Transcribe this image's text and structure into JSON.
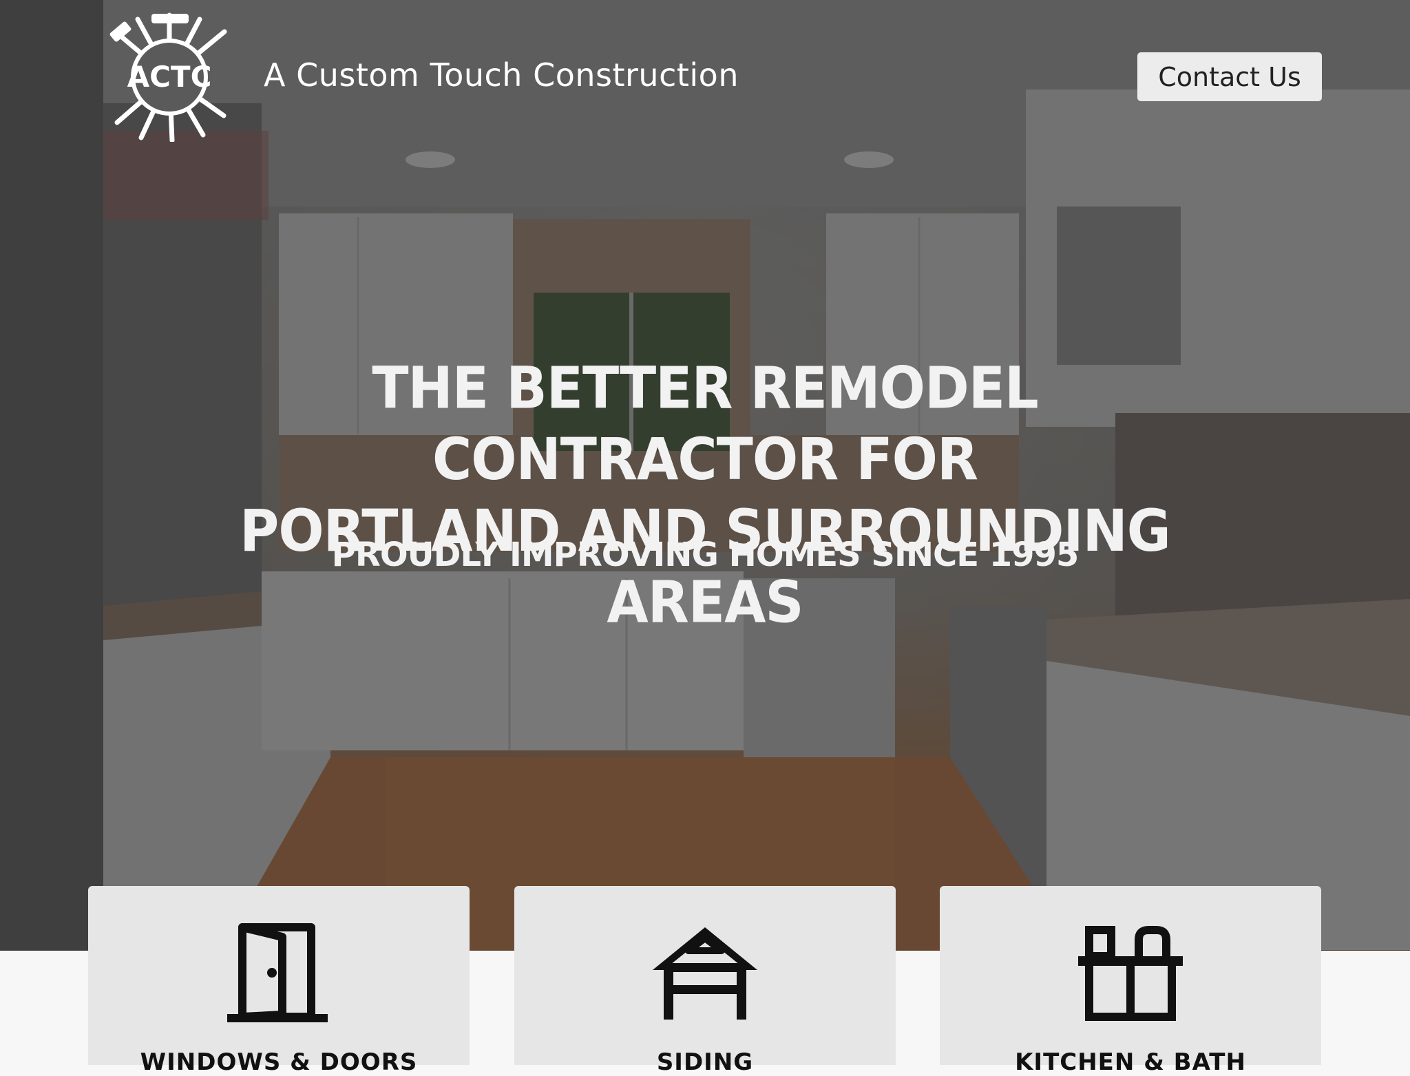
{
  "header": {
    "logo_text": "ACTC",
    "site_title": "A Custom Touch Construction",
    "contact_label": "Contact Us"
  },
  "hero": {
    "headline_line1": "THE BETTER REMODEL CONTRACTOR FOR",
    "headline_line2": "PORTLAND AND SURROUNDING AREAS",
    "subheadline": "PROUDLY IMPROVING HOMES SINCE 1995"
  },
  "services": [
    {
      "label": "WINDOWS & DOORS",
      "icon": "door-icon"
    },
    {
      "label": "SIDING",
      "icon": "house-siding-icon"
    },
    {
      "label": "KITCHEN & BATH",
      "icon": "kitchen-cabinet-icon"
    }
  ],
  "colors": {
    "card_bg": "#e6e6e6",
    "button_bg": "#ececec",
    "hero_text": "#f2f2f2"
  }
}
